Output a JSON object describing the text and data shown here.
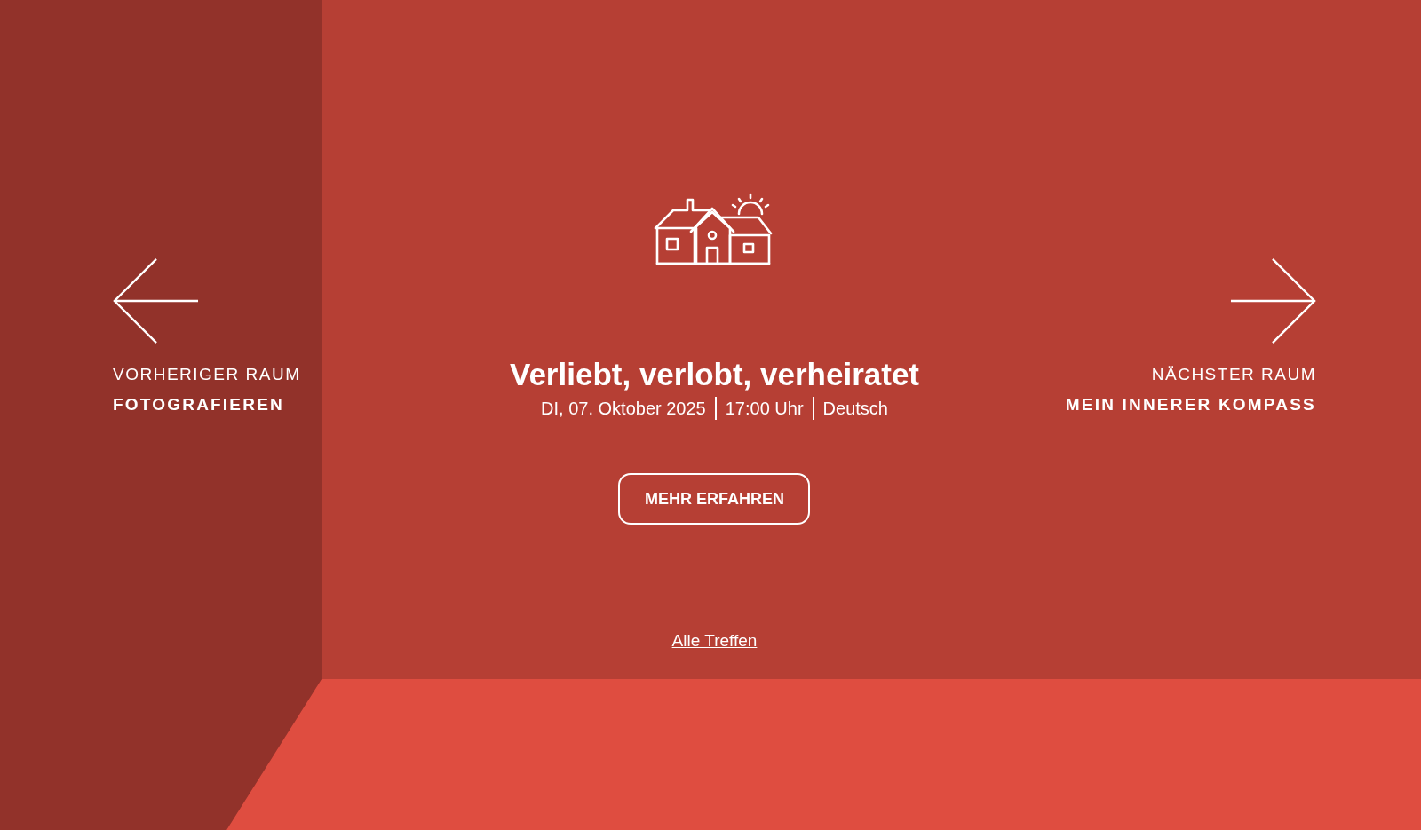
{
  "previous": {
    "label": "VORHERIGER RAUM",
    "title": "FOTOGRAFIEREN"
  },
  "event": {
    "title": "Verliebt, verlobt, verheiratet",
    "meta": [
      "DI, 07. Oktober 2025",
      "17:00 Uhr",
      "Deutsch"
    ],
    "button": "MEHR ERFAHREN"
  },
  "next": {
    "label": "NÄCHSTER RAUM",
    "title": "MEIN INNERER KOMPASS"
  },
  "link": "Alle Treffen"
}
